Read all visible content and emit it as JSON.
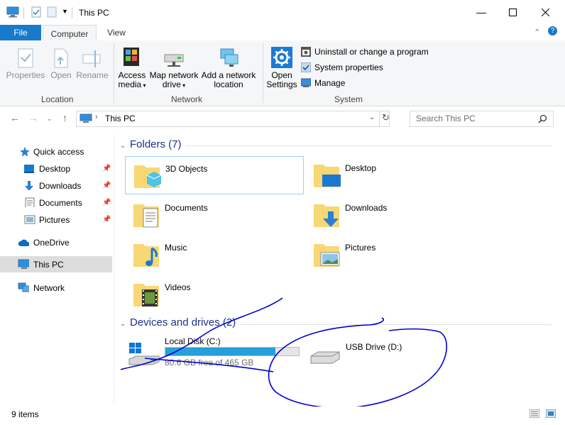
{
  "window": {
    "title": "This PC"
  },
  "tabs": {
    "file": "File",
    "computer": "Computer",
    "view": "View"
  },
  "ribbon": {
    "location": {
      "group": "Location",
      "properties": "Properties",
      "open": "Open",
      "rename": "Rename"
    },
    "network": {
      "group": "Network",
      "access_media_1": "Access",
      "access_media_2": "media",
      "map_drive_1": "Map network",
      "map_drive_2": "drive",
      "add_location_1": "Add a network",
      "add_location_2": "location"
    },
    "system": {
      "group": "System",
      "open_settings_1": "Open",
      "open_settings_2": "Settings",
      "uninstall": "Uninstall or change a program",
      "system_properties": "System properties",
      "manage": "Manage"
    }
  },
  "address": {
    "path": "This PC",
    "search_placeholder": "Search This PC"
  },
  "nav": {
    "quick_access": "Quick access",
    "desktop": "Desktop",
    "downloads": "Downloads",
    "documents": "Documents",
    "pictures": "Pictures",
    "onedrive": "OneDrive",
    "this_pc": "This PC",
    "network": "Network"
  },
  "folders": {
    "heading": "Folders (7)",
    "items": [
      "3D Objects",
      "Desktop",
      "Documents",
      "Downloads",
      "Music",
      "Pictures",
      "Videos"
    ]
  },
  "drives": {
    "heading": "Devices and drives (2)",
    "local": {
      "name": "Local Disk (C:)",
      "free": "80.6 GB free of 465 GB",
      "used_fraction": 0.827
    },
    "usb": {
      "name": "USB Drive (D:)"
    }
  },
  "status": {
    "items": "9 items"
  },
  "colors": {
    "accent": "#1979ca",
    "section": "#1e3287",
    "bar": "#26a0da",
    "ink": "#0000cc"
  }
}
